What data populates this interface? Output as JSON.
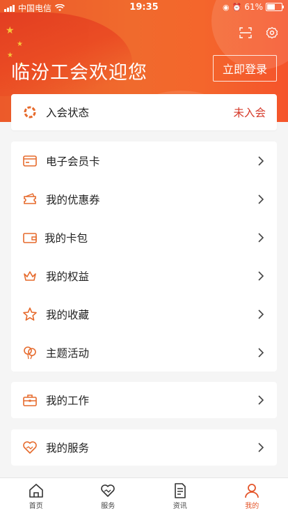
{
  "status_bar": {
    "carrier": "中国电信",
    "time": "19:35",
    "battery": "61%",
    "battery_level": 0.61
  },
  "header": {
    "welcome": "临汾工会欢迎您",
    "login_button": "立即登录"
  },
  "membership": {
    "label": "入会状态",
    "value": "未入会"
  },
  "menu": [
    {
      "label": "电子会员卡",
      "icon": "card-icon"
    },
    {
      "label": "我的优惠券",
      "icon": "coupon-icon"
    },
    {
      "label": "我的卡包",
      "icon": "wallet-icon"
    },
    {
      "label": "我的权益",
      "icon": "crown-icon"
    },
    {
      "label": "我的收藏",
      "icon": "star-icon"
    },
    {
      "label": "主题活动",
      "icon": "balloon-icon"
    }
  ],
  "work": {
    "label": "我的工作",
    "icon": "briefcase-icon"
  },
  "service": {
    "label": "我的服务",
    "icon": "handshake-heart-icon"
  },
  "tabs": [
    {
      "label": "首页",
      "icon": "home-icon",
      "active": false
    },
    {
      "label": "服务",
      "icon": "heart-hand-icon",
      "active": false
    },
    {
      "label": "资讯",
      "icon": "document-icon",
      "active": false
    },
    {
      "label": "我的",
      "icon": "person-icon",
      "active": true
    }
  ],
  "colors": {
    "accent": "#e4552a",
    "status_red": "#d63a2a",
    "icon_orange": "#e66a2c"
  }
}
